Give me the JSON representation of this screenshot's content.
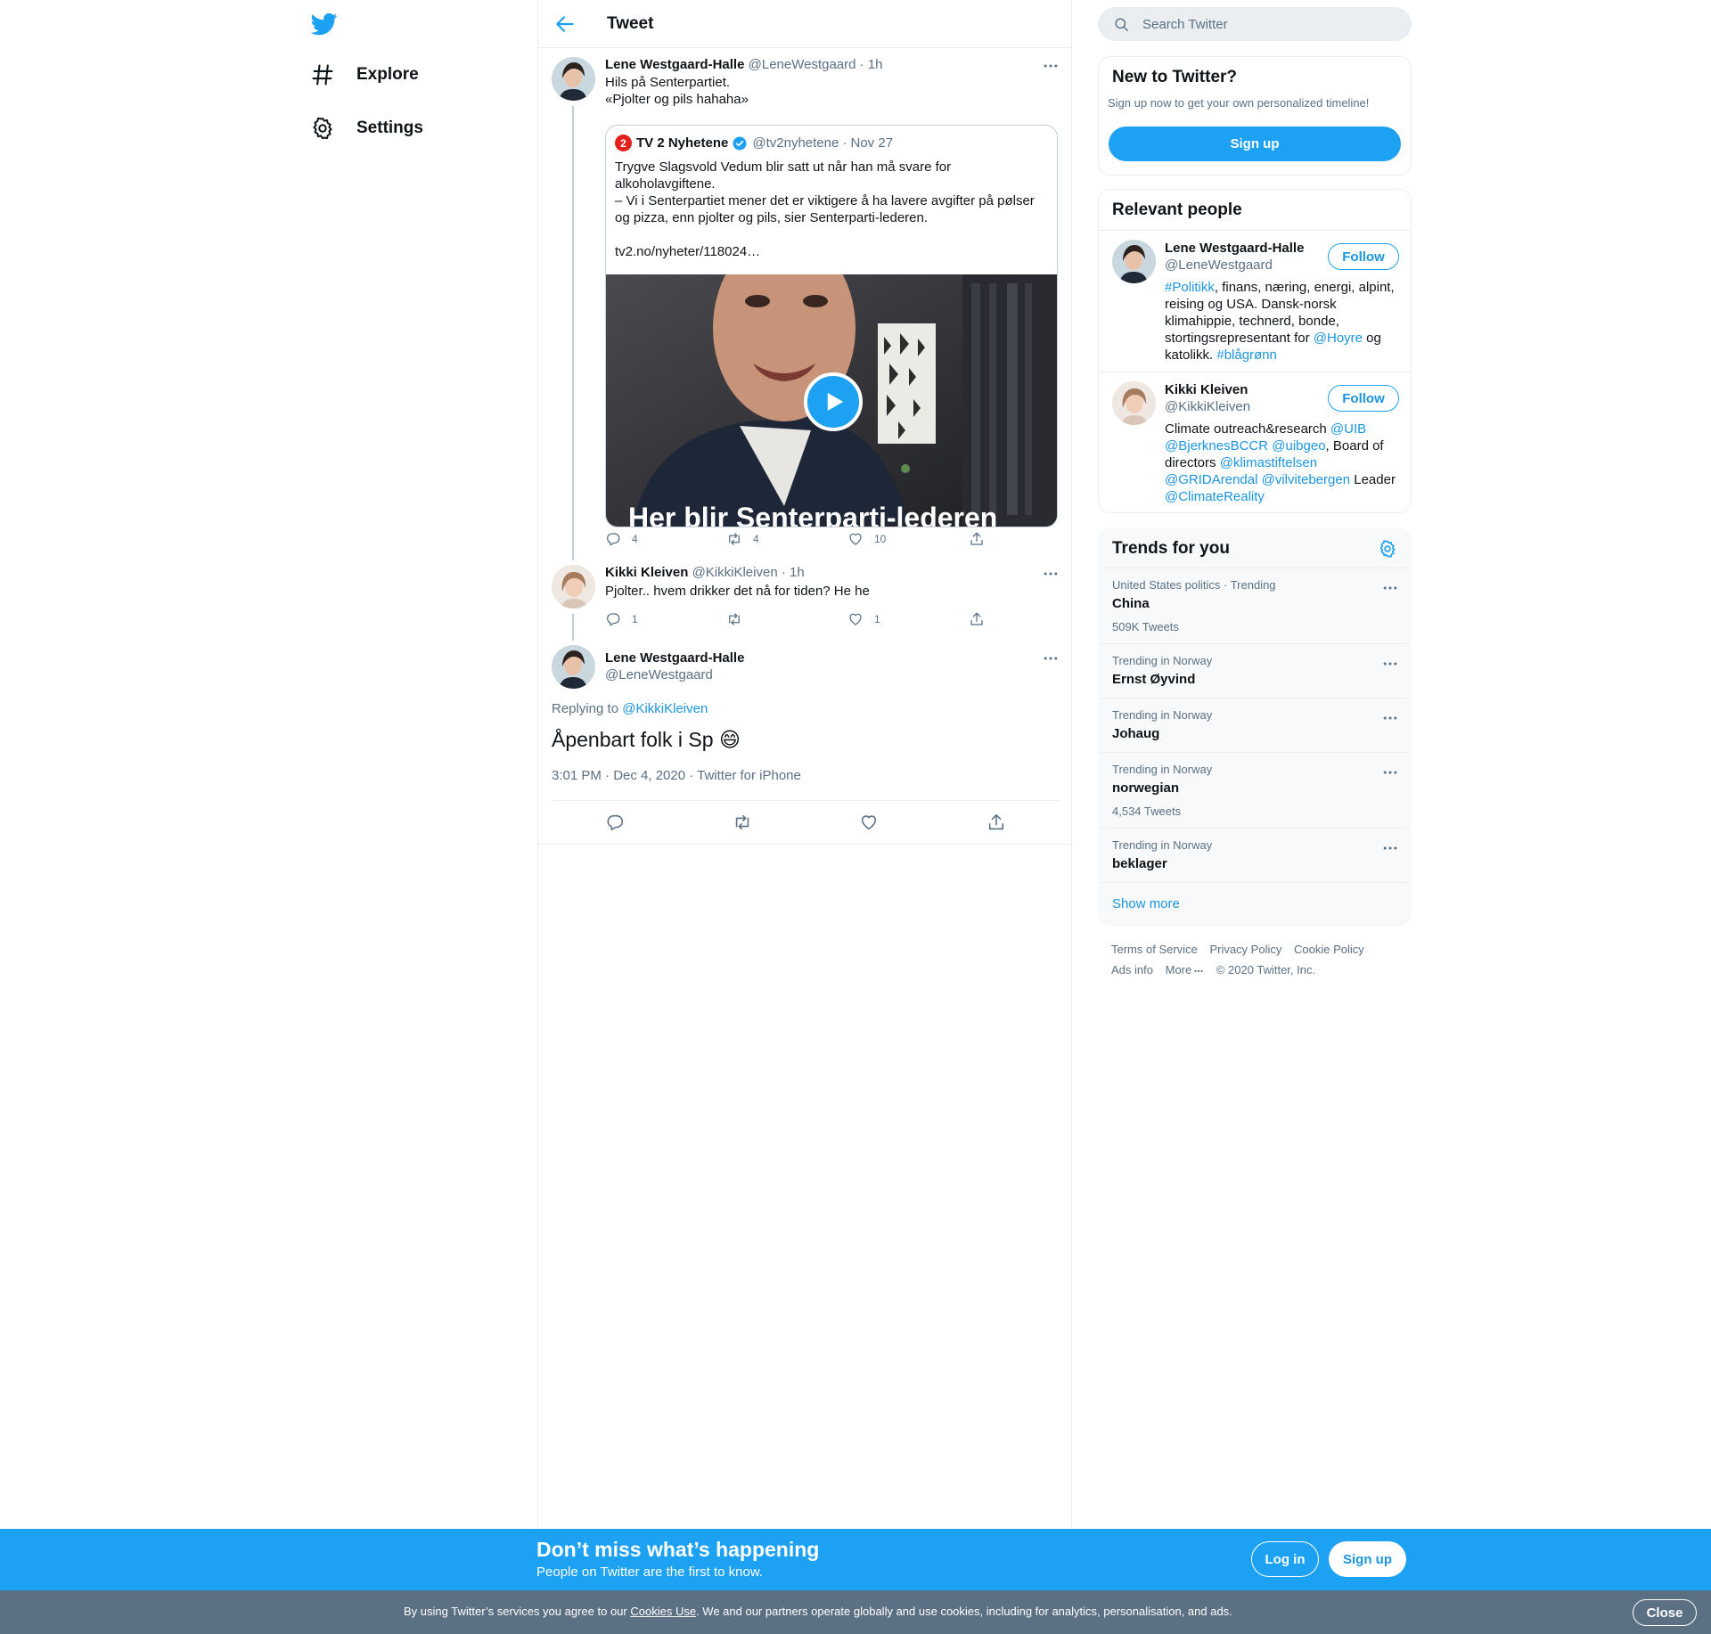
{
  "nav": {
    "explore_label": "Explore",
    "settings_label": "Settings"
  },
  "header": {
    "title": "Tweet"
  },
  "thread": {
    "first": {
      "name": "Lene Westgaard-Halle",
      "handle": "@LeneWestgaard",
      "time": "· 1h",
      "text_line1": "Hils på Senterpartiet.",
      "text_line2": "«Pjolter og pils hahaha»",
      "quote": {
        "logo_text": "2",
        "name": "TV 2 Nyhetene",
        "handle": "@tv2nyhetene",
        "date": "· Nov 27",
        "text_line1": "Trygve Slagsvold Vedum blir satt ut når han må svare for alkoholavgiftene.",
        "text_line2": "– Vi i Senterpartiet mener det er viktigere å ha lavere avgifter på pølser og pizza, enn pjolter og pils, sier Senterparti-lederen.",
        "link": "tv2.no/nyheter/118024…",
        "caption": "Her blir Senterparti-lederen"
      },
      "replies": "4",
      "retweets": "4",
      "likes": "10"
    },
    "second": {
      "name": "Kikki Kleiven",
      "handle": "@KikkiKleiven",
      "time": "· 1h",
      "text": "Pjolter.. hvem drikker det nå for tiden? He he",
      "replies": "1",
      "retweets": "",
      "likes": "1"
    },
    "main": {
      "name": "Lene Westgaard-Halle",
      "handle": "@LeneWestgaard",
      "replying_prefix": "Replying to",
      "replying_to": "@KikkiKleiven",
      "text": "Åpenbart folk i Sp",
      "emoji": "😄",
      "meta": "3:01 PM · Dec 4, 2020 · Twitter for iPhone"
    }
  },
  "search": {
    "placeholder": "Search Twitter"
  },
  "new_to_twitter": {
    "title": "New to Twitter?",
    "subtitle": "Sign up now to get your own personalized timeline!",
    "signup_label": "Sign up"
  },
  "relevant": {
    "title": "Relevant people",
    "follow_label": "Follow",
    "people": [
      {
        "name": "Lene Westgaard-Halle",
        "handle": "@LeneWestgaard",
        "bio_hashtag1": "#Politikk",
        "bio_part1": ", finans, næring, energi, alpint, reising og USA. Dansk-norsk klimahippie, technerd, bonde, stortingsrepresentant for ",
        "bio_mention1": "@Hoyre",
        "bio_part2": " og katolikk. ",
        "bio_hashtag2": "#blågrønn"
      },
      {
        "name": "Kikki Kleiven",
        "handle": "@KikkiKleiven",
        "bio_part1": "Climate outreach&research ",
        "bio_mention1": "@UIB",
        "bio_mention2": "@BjerknesBCCR",
        "bio_mention3": "@uibgeo",
        "bio_part2": ", Board of directors ",
        "bio_mention4": "@klimastiftelsen",
        "bio_mention5": "@GRIDArendal",
        "bio_mention6": "@vilvitebergen",
        "bio_part3": " Leader ",
        "bio_mention7": "@ClimateReality"
      }
    ]
  },
  "trends": {
    "title": "Trends for you",
    "items": [
      {
        "context": "United States politics · Trending",
        "name": "China",
        "count": "509K Tweets"
      },
      {
        "context": "Trending in Norway",
        "name": "Ernst Øyvind",
        "count": ""
      },
      {
        "context": "Trending in Norway",
        "name": "Johaug",
        "count": ""
      },
      {
        "context": "Trending in Norway",
        "name": "norwegian",
        "count": "4,534 Tweets"
      },
      {
        "context": "Trending in Norway",
        "name": "beklager",
        "count": ""
      }
    ],
    "show_more": "Show more"
  },
  "footer": {
    "terms": "Terms of Service",
    "privacy": "Privacy Policy",
    "cookie": "Cookie Policy",
    "ads": "Ads info",
    "more": "More",
    "copyright": "© 2020 Twitter, Inc."
  },
  "banner": {
    "title": "Don’t miss what’s happening",
    "subtitle": "People on Twitter are the first to know.",
    "login_label": "Log in",
    "signup_label": "Sign up"
  },
  "cookie": {
    "prefix": "By using Twitter’s services you agree to our ",
    "link": "Cookies Use",
    "suffix": ". We and our partners operate globally and use cookies, including for analytics, personalisation, and ads.",
    "close_label": "Close"
  },
  "colors": {
    "accent": "#1da1f2",
    "link": "#1b95e0",
    "muted": "#5b7083",
    "cookie_bar": "#5b7083"
  }
}
